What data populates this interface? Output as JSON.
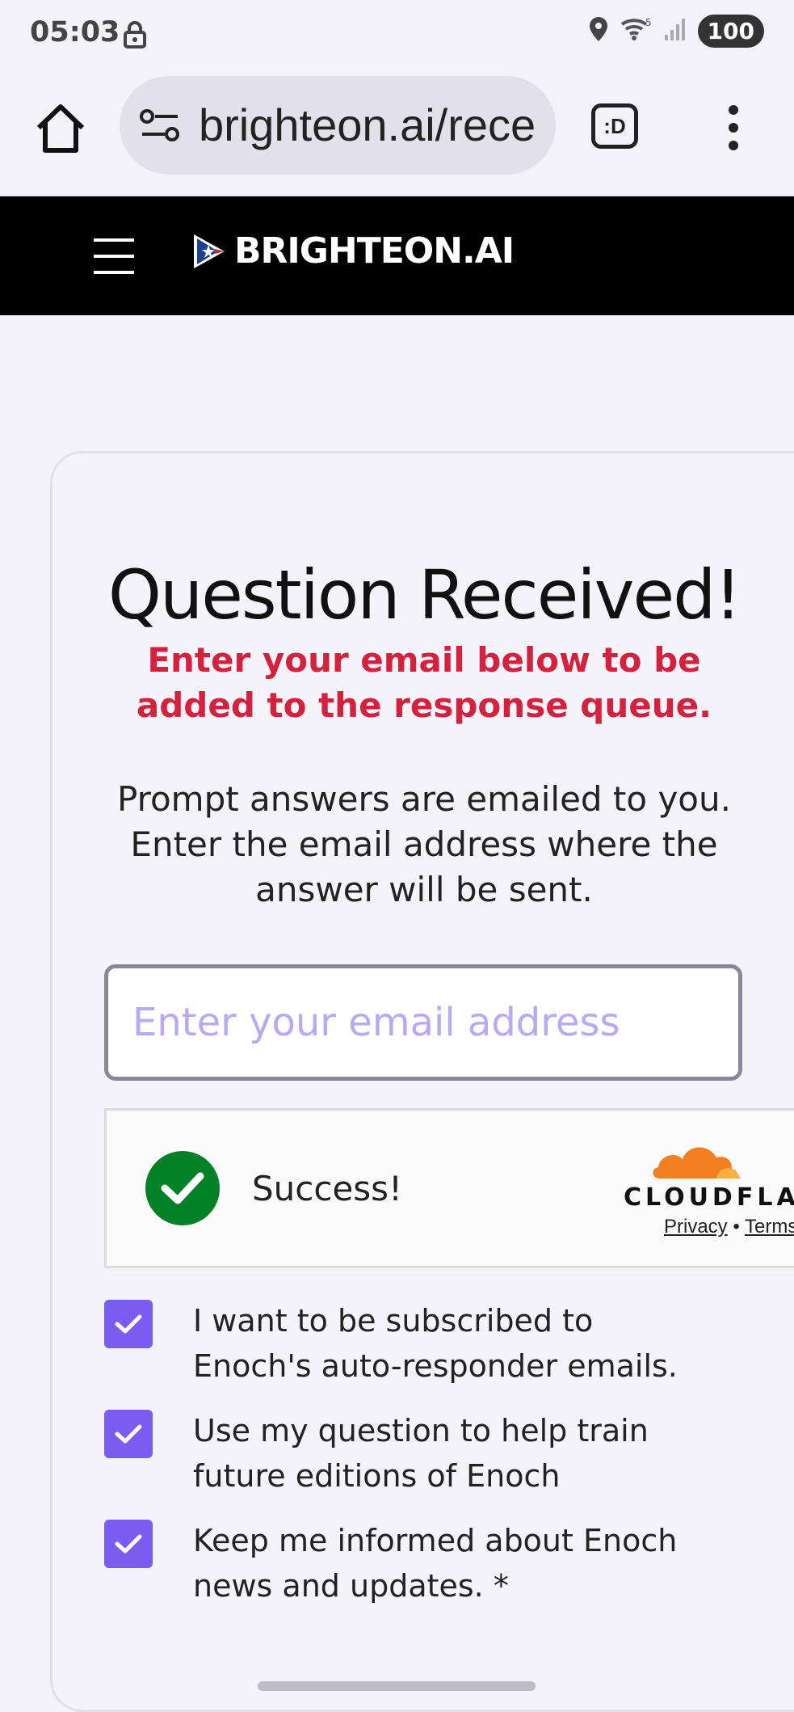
{
  "status_bar": {
    "time": "05:03",
    "battery": "100",
    "wifi_badge": "5"
  },
  "browser": {
    "url": "brighteon.ai/rece",
    "tab_icon_label": ":D"
  },
  "site": {
    "brand": "BRIGHTEON.AI"
  },
  "card": {
    "title": "Question Received!",
    "alert": "Enter your email below to be added to the response queue.",
    "info": "Prompt answers are emailed to you. Enter the email address where the answer will be sent.",
    "email_placeholder": "Enter your email address",
    "email_value": ""
  },
  "turnstile": {
    "status": "Success!",
    "brand": "CLOUDFLARE",
    "privacy": "Privacy",
    "terms": "Terms",
    "separator": "•"
  },
  "checkboxes": [
    {
      "label": "I want to be subscribed to Enoch's auto-responder emails.",
      "checked": true
    },
    {
      "label": "Use my question to help train future editions of Enoch",
      "checked": true
    },
    {
      "label": "Keep me informed about Enoch news and updates. *",
      "checked": true
    }
  ],
  "colors": {
    "accent_purple": "#7a5cf2",
    "alert_red": "#d4213d",
    "success_green": "#038126",
    "cloudflare_orange": "#f38020"
  }
}
